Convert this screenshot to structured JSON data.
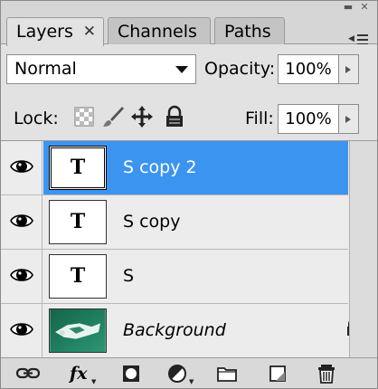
{
  "window": {
    "minimize_glyph": "▬",
    "close_glyph": "✕"
  },
  "tabs": [
    {
      "label": "Layers",
      "active": true,
      "close_glyph": "✕"
    },
    {
      "label": "Channels",
      "active": false
    },
    {
      "label": "Paths",
      "active": false
    }
  ],
  "panel_menu_icon": "panel-menu-icon",
  "blend": {
    "value": "Normal"
  },
  "opacity": {
    "label": "Opacity:",
    "value": "100%"
  },
  "lock": {
    "label": "Lock:",
    "icons": [
      "lock-transparent-pixels-icon",
      "lock-image-pixels-icon",
      "lock-position-icon",
      "lock-all-icon"
    ]
  },
  "fill": {
    "label": "Fill:",
    "value": "100%"
  },
  "layers": [
    {
      "name": "S copy 2",
      "thumb": "T",
      "visible": true,
      "selected": true
    },
    {
      "name": "S copy",
      "thumb": "T",
      "visible": true,
      "selected": false
    },
    {
      "name": "S",
      "thumb": "T",
      "visible": true,
      "selected": false
    },
    {
      "name": "Background",
      "thumb": "image",
      "visible": true,
      "selected": false,
      "locked": true
    }
  ],
  "bottom_bar": {
    "fx_label": "fx",
    "icons": [
      "link-layers-icon",
      "layer-style-icon",
      "add-mask-icon",
      "adjustment-layer-icon",
      "new-group-icon",
      "new-layer-icon",
      "delete-layer-icon"
    ]
  },
  "colors": {
    "selection": "#3b95f0",
    "panel_bg": "#e2e2e2",
    "list_bg": "#ececec"
  }
}
